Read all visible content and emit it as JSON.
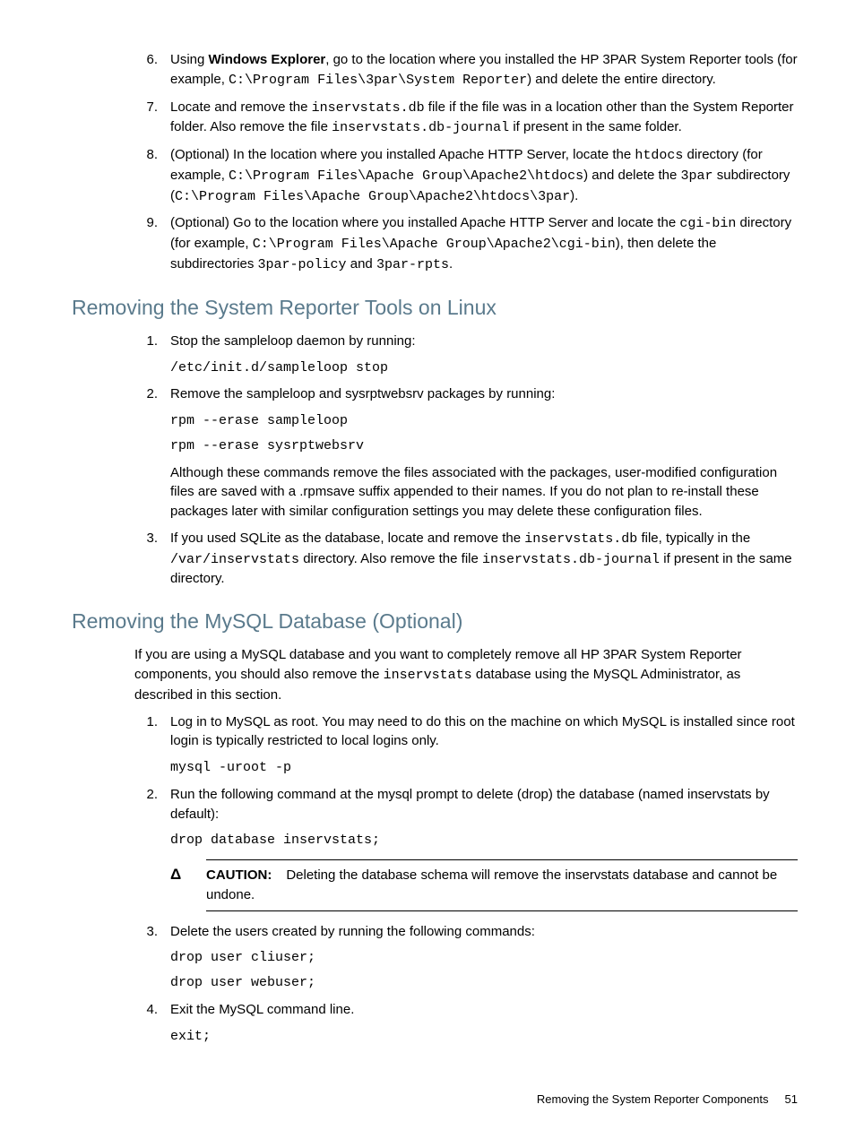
{
  "top_list": {
    "start": 6,
    "items": [
      {
        "num": "6.",
        "parts": [
          {
            "t": "text",
            "v": "Using "
          },
          {
            "t": "strong",
            "v": "Windows Explorer"
          },
          {
            "t": "text",
            "v": ", go to the location where you installed the HP 3PAR System Reporter tools (for example, "
          },
          {
            "t": "code",
            "v": "C:\\Program Files\\3par\\System Reporter"
          },
          {
            "t": "text",
            "v": ") and delete the entire directory."
          }
        ]
      },
      {
        "num": "7.",
        "parts": [
          {
            "t": "text",
            "v": "Locate and remove the "
          },
          {
            "t": "code",
            "v": "inservstats.db"
          },
          {
            "t": "text",
            "v": " file if the file was in a location other than the System Reporter folder. Also remove the file "
          },
          {
            "t": "code",
            "v": "inservstats.db-journal"
          },
          {
            "t": "text",
            "v": " if present in the same folder."
          }
        ]
      },
      {
        "num": "8.",
        "parts": [
          {
            "t": "text",
            "v": "(Optional) In the location where you installed Apache HTTP Server, locate the "
          },
          {
            "t": "code",
            "v": "htdocs"
          },
          {
            "t": "text",
            "v": " directory (for example, "
          },
          {
            "t": "code",
            "v": "C:\\Program Files\\Apache Group\\Apache2\\htdocs"
          },
          {
            "t": "text",
            "v": ") and delete the "
          },
          {
            "t": "code",
            "v": "3par"
          },
          {
            "t": "text",
            "v": " subdirectory ("
          },
          {
            "t": "code",
            "v": "C:\\Program Files\\Apache Group\\Apache2\\htdocs\\3par"
          },
          {
            "t": "text",
            "v": ")."
          }
        ]
      },
      {
        "num": "9.",
        "parts": [
          {
            "t": "text",
            "v": "(Optional) Go to the location where you installed Apache HTTP Server and locate the "
          },
          {
            "t": "code",
            "v": "cgi-bin"
          },
          {
            "t": "text",
            "v": " directory (for example, "
          },
          {
            "t": "code",
            "v": "C:\\Program Files\\Apache Group\\Apache2\\cgi-bin"
          },
          {
            "t": "text",
            "v": "), then delete the subdirectories "
          },
          {
            "t": "code",
            "v": "3par-policy"
          },
          {
            "t": "text",
            "v": " and "
          },
          {
            "t": "code",
            "v": "3par-rpts"
          },
          {
            "t": "text",
            "v": "."
          }
        ]
      }
    ]
  },
  "section1": {
    "heading": "Removing the System Reporter Tools on Linux",
    "items": [
      {
        "num": "1.",
        "body": [
          {
            "t": "para",
            "parts": [
              {
                "t": "text",
                "v": "Stop the sampleloop daemon by running:"
              }
            ]
          },
          {
            "t": "codeblock",
            "v": "/etc/init.d/sampleloop stop"
          }
        ]
      },
      {
        "num": "2.",
        "body": [
          {
            "t": "para",
            "parts": [
              {
                "t": "text",
                "v": "Remove the sampleloop and sysrptwebsrv packages by running:"
              }
            ]
          },
          {
            "t": "codeblock",
            "v": "rpm --erase sampleloop"
          },
          {
            "t": "codeblock",
            "v": "rpm --erase sysrptwebsrv"
          },
          {
            "t": "para",
            "parts": [
              {
                "t": "text",
                "v": "Although these commands remove the files associated with the packages, user-modified configuration files are saved with a .rpmsave suffix appended to their names. If you do not plan to re-install these packages later with similar configuration settings you may delete these configuration files."
              }
            ]
          }
        ]
      },
      {
        "num": "3.",
        "body": [
          {
            "t": "para",
            "parts": [
              {
                "t": "text",
                "v": "If you used SQLite as the database, locate and remove the "
              },
              {
                "t": "code",
                "v": "inservstats.db"
              },
              {
                "t": "text",
                "v": " file, typically in the "
              },
              {
                "t": "code",
                "v": "/var/inservstats"
              },
              {
                "t": "text",
                "v": " directory. Also remove the file "
              },
              {
                "t": "code",
                "v": "inservstats.db-journal"
              },
              {
                "t": "text",
                "v": " if present in the same directory."
              }
            ]
          }
        ]
      }
    ]
  },
  "section2": {
    "heading": "Removing the MySQL Database (Optional)",
    "intro_parts": [
      {
        "t": "text",
        "v": "If you are using a MySQL database and you want to completely remove all HP 3PAR System Reporter components, you should also remove the "
      },
      {
        "t": "code",
        "v": "inservstats"
      },
      {
        "t": "text",
        "v": " database using the MySQL Administrator, as described in this section."
      }
    ],
    "items": [
      {
        "num": "1.",
        "body": [
          {
            "t": "para",
            "parts": [
              {
                "t": "text",
                "v": "Log in to MySQL as root. You may need to do this on the machine on which MySQL is installed since root login is typically restricted to local logins only."
              }
            ]
          },
          {
            "t": "codeblock",
            "v": "mysql -uroot -p"
          }
        ]
      },
      {
        "num": "2.",
        "body": [
          {
            "t": "para",
            "parts": [
              {
                "t": "text",
                "v": "Run the following command at the mysql prompt to delete (drop) the database (named inservstats by default):"
              }
            ]
          },
          {
            "t": "codeblock",
            "v": "drop database inservstats;"
          },
          {
            "t": "caution",
            "label": "CAUTION:",
            "text": "Deleting the database schema will remove the inservstats database and cannot be undone."
          }
        ]
      },
      {
        "num": "3.",
        "body": [
          {
            "t": "para",
            "parts": [
              {
                "t": "text",
                "v": "Delete the users created by running the following commands:"
              }
            ]
          },
          {
            "t": "codeblock",
            "v": "drop user cliuser;"
          },
          {
            "t": "codeblock",
            "v": "drop user webuser;"
          }
        ]
      },
      {
        "num": "4.",
        "body": [
          {
            "t": "para",
            "parts": [
              {
                "t": "text",
                "v": "Exit the MySQL command line."
              }
            ]
          },
          {
            "t": "codeblock",
            "v": "exit;"
          }
        ]
      }
    ]
  },
  "footer": {
    "text": "Removing the System Reporter Components",
    "page": "51"
  }
}
